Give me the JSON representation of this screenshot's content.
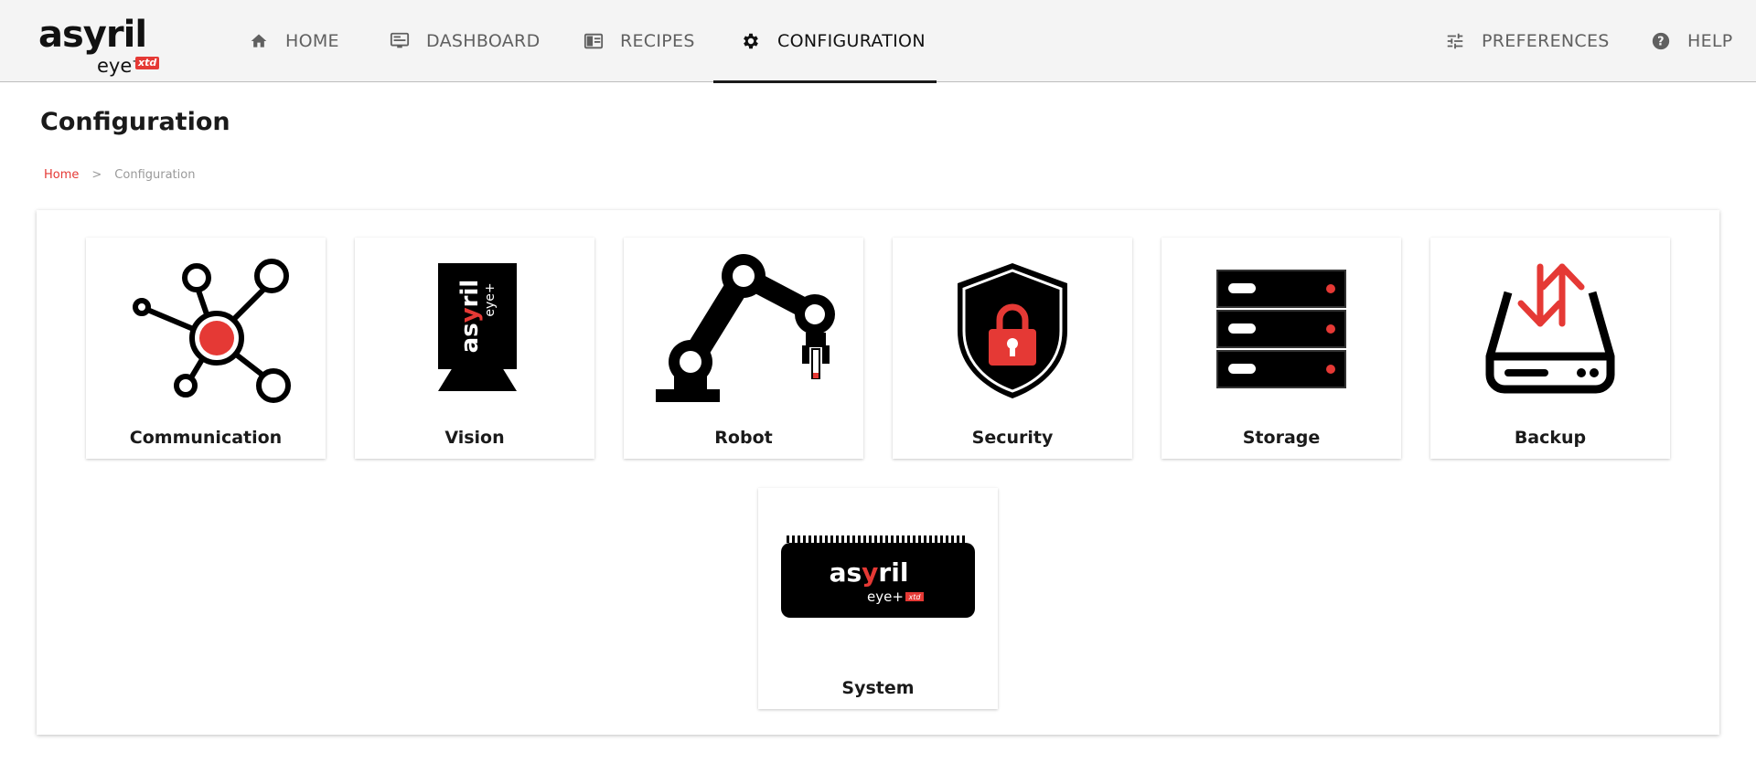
{
  "brand": {
    "logo_main": "asyril",
    "logo_sub": "eye",
    "logo_sup": "+",
    "logo_tag": "xtd",
    "accent_color": "#e53935"
  },
  "nav": {
    "home": {
      "label": "HOME",
      "icon": "home-icon"
    },
    "dashboard": {
      "label": "DASHBOARD",
      "icon": "monitor-icon"
    },
    "recipes": {
      "label": "RECIPES",
      "icon": "book-icon"
    },
    "configuration": {
      "label": "CONFIGURATION",
      "icon": "gear-icon",
      "active": true
    },
    "preferences": {
      "label": "PREFERENCES",
      "icon": "sliders-icon"
    },
    "help": {
      "label": "HELP",
      "icon": "help-circle-icon"
    }
  },
  "page": {
    "title": "Configuration",
    "breadcrumb": {
      "home": "Home",
      "separator": ">",
      "current": "Configuration"
    }
  },
  "tiles": [
    {
      "label": "Communication",
      "icon": "network-icon"
    },
    {
      "label": "Vision",
      "icon": "vision-camera-icon"
    },
    {
      "label": "Robot",
      "icon": "robot-arm-icon"
    },
    {
      "label": "Security",
      "icon": "shield-lock-icon"
    },
    {
      "label": "Storage",
      "icon": "server-rack-icon"
    },
    {
      "label": "Backup",
      "icon": "drive-transfer-icon"
    },
    {
      "label": "System",
      "icon": "controller-board-icon"
    }
  ]
}
